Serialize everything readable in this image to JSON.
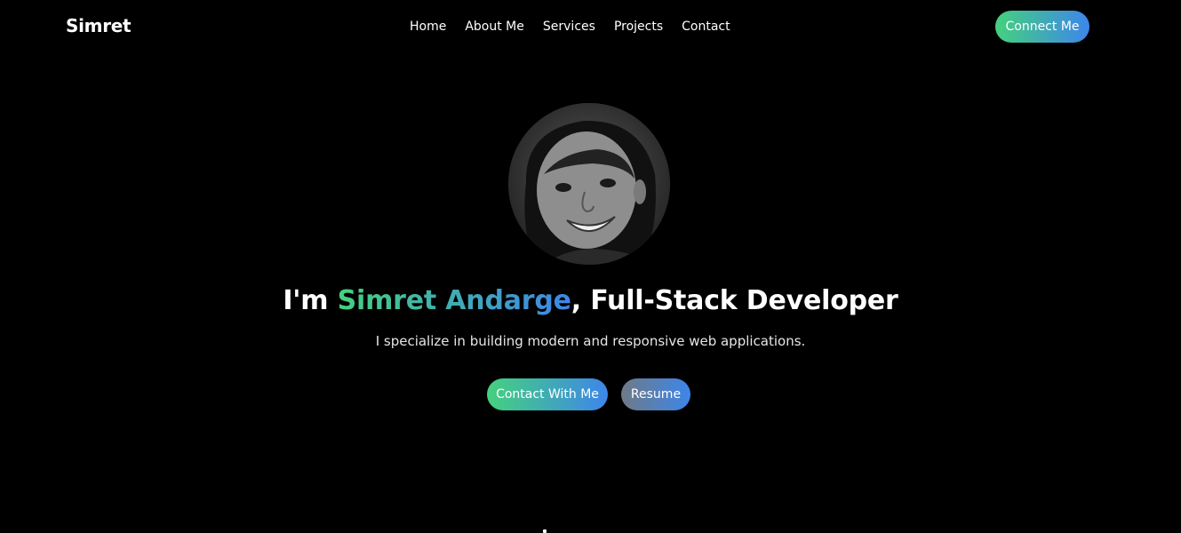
{
  "navbar": {
    "logo": "Simret",
    "links": [
      "Home",
      "About Me",
      "Services",
      "Projects",
      "Contact"
    ],
    "connect_label": "Connect Me"
  },
  "hero": {
    "greeting": "I'm ",
    "name": "Simret Andarge",
    "role": ", Full-Stack Developer",
    "subtitle": "I specialize in building modern and responsive web applications.",
    "contact_button": "Contact With Me",
    "resume_button": "Resume",
    "avatar_icon": "profile-photo"
  },
  "colors": {
    "background": "#000000",
    "gradient_start": "#45d17e",
    "gradient_end": "#3d86ea",
    "text": "#ffffff"
  }
}
